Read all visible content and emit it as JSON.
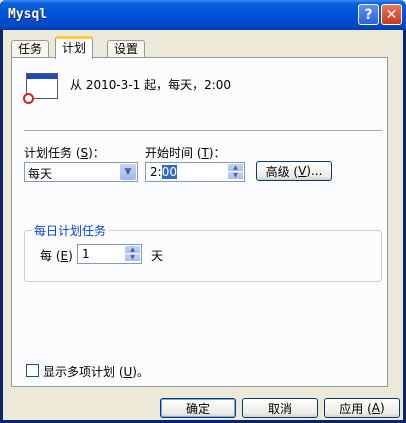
{
  "window": {
    "title": "Mysql"
  },
  "titlebar_buttons": {
    "help": "?",
    "close": "✕"
  },
  "tabs": [
    {
      "label": "任务"
    },
    {
      "label": "计划"
    },
    {
      "label": "设置"
    }
  ],
  "summary": {
    "text": "从 2010-3-1 起，每天，2:00"
  },
  "schedule_task": {
    "label_prefix": "计划任务 (",
    "label_key": "S",
    "label_suffix": ")：",
    "value": "每天"
  },
  "start_time": {
    "label_prefix": "开始时间 (",
    "label_key": "T",
    "label_suffix": ")：",
    "hour": "2:",
    "minute": "00"
  },
  "advanced_button": {
    "prefix": "高级 (",
    "key": "V",
    "suffix": ")..."
  },
  "daily": {
    "group_title": "每日计划任务",
    "every_prefix": "每 (",
    "every_key": "E",
    "every_suffix": ")",
    "value": "1",
    "unit": "天"
  },
  "multiple": {
    "prefix": "显示多项计划 (",
    "key": "U",
    "suffix": ")。"
  },
  "footer": {
    "ok": "确定",
    "cancel": "取消",
    "apply_prefix": "应用 (",
    "apply_key": "A",
    "apply_suffix": ")"
  }
}
